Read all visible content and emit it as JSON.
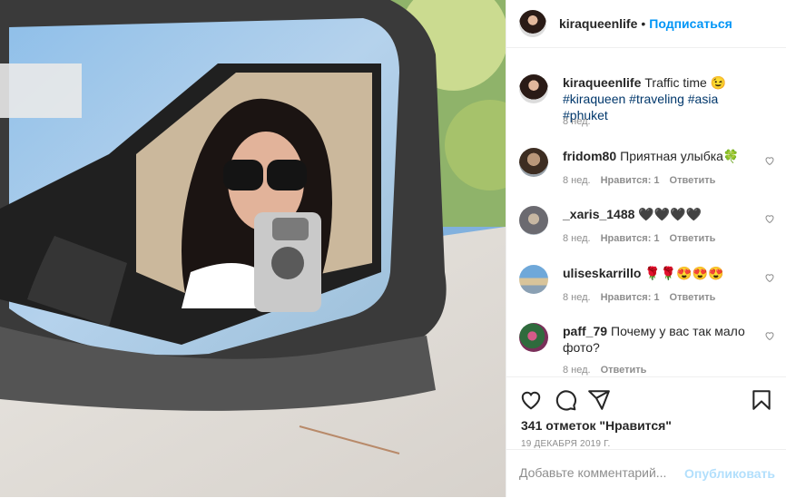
{
  "header": {
    "username": "kiraqueenlife",
    "separator": "•",
    "follow_label": "Подписаться"
  },
  "caption": {
    "username": "kiraqueenlife",
    "text": "Traffic time 😉",
    "hashtags": [
      "#kiraqueen",
      "#traveling",
      "#asia",
      "#phuket"
    ],
    "time": "8 нед."
  },
  "comments": [
    {
      "username": "fridom80",
      "text": "Приятная улыбка🍀",
      "time": "8 нед.",
      "likes": "Нравится: 1",
      "reply": "Ответить"
    },
    {
      "username": "_xaris_1488",
      "text": "🖤🖤🖤🖤",
      "time": "8 нед.",
      "likes": "Нравится: 1",
      "reply": "Ответить"
    },
    {
      "username": "uliseskarrillo",
      "text": "🌹🌹😍😍😍",
      "time": "8 нед.",
      "likes": "Нравится: 1",
      "reply": "Ответить"
    },
    {
      "username": "paff_79",
      "text": "Почему у вас так мало фото?",
      "time": "8 нед.",
      "reply": "Ответить"
    }
  ],
  "post": {
    "likes_text": "341 отметок \"Нравится\"",
    "date": "19 ДЕКАБРЯ 2019 Г."
  },
  "add_comment": {
    "placeholder": "Добавьте комментарий...",
    "publish_label": "Опубликовать"
  },
  "colors": {
    "link": "#0095f6",
    "hashtag": "#00376b",
    "muted": "#8e8e8e",
    "publish_disabled": "#b2dffc"
  },
  "icons": [
    "heart-icon",
    "comment-icon",
    "share-icon",
    "bookmark-icon"
  ]
}
